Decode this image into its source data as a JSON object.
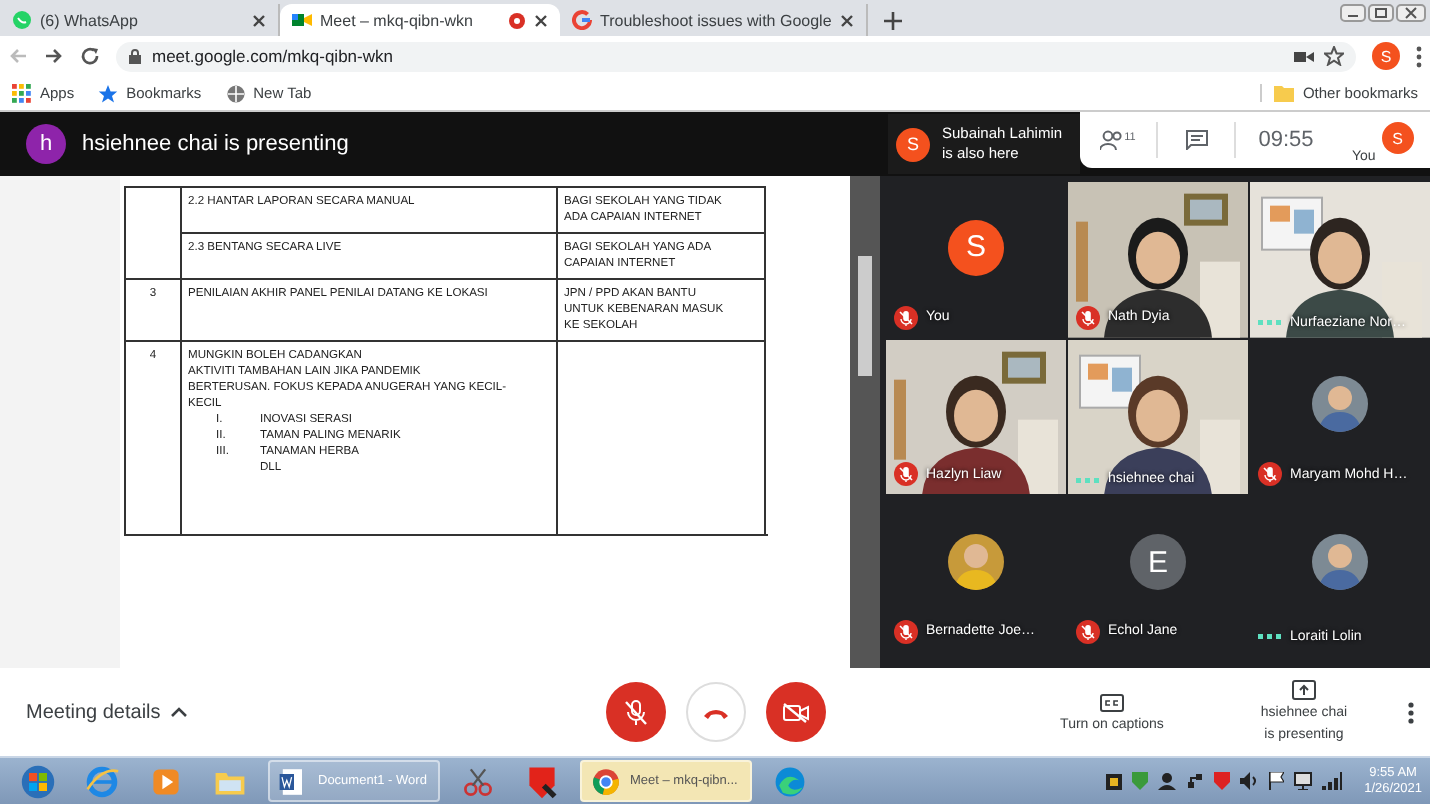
{
  "browser": {
    "tabs": [
      {
        "title": "(6) WhatsApp",
        "kind": "whatsapp",
        "selected": false,
        "capturing": false
      },
      {
        "title": "Meet – mkq-qibn-wkn",
        "kind": "meet",
        "selected": true,
        "capturing": true
      },
      {
        "title": "Troubleshoot issues with Google",
        "kind": "google",
        "selected": false,
        "capturing": false
      }
    ],
    "address": "meet.google.com/mkq-qibn-wkn",
    "profile": "S",
    "bookmarks": [
      {
        "label": "Apps",
        "kind": "apps"
      },
      {
        "label": "Bookmarks",
        "kind": "star"
      },
      {
        "label": "New Tab",
        "kind": "globe"
      }
    ],
    "other_bookmarks": "Other bookmarks"
  },
  "meet": {
    "presenter_initial": "h",
    "presenting_text": "hsiehnee chai is presenting",
    "notice": {
      "initial": "S",
      "lines": [
        "Subainah Lahimin",
        "is also here"
      ]
    },
    "people_count": "11",
    "time": "09:55",
    "self": {
      "label": "You",
      "initial": "S"
    },
    "document": {
      "rows": [
        {
          "number": "",
          "content": [
            {
              "kind": "line",
              "text": "2.2 HANTAR LAPORAN SECARA MANUAL"
            }
          ],
          "note": [
            "BAGI SEKOLAH YANG TIDAK",
            "ADA CAPAIAN INTERNET"
          ]
        },
        {
          "number": "",
          "content": [
            {
              "kind": "line",
              "text": "2.3 BENTANG SECARA LIVE"
            }
          ],
          "note": [
            "BAGI SEKOLAH YANG ADA",
            "CAPAIAN INTERNET"
          ]
        },
        {
          "number": "3",
          "content": [
            {
              "kind": "line",
              "text": "PENILAIAN AKHIR PANEL PENILAI  DATANG KE LOKASI"
            }
          ],
          "note": [
            "JPN / PPD AKAN BANTU",
            "UNTUK KEBENARAN MASUK",
            "KE SEKOLAH"
          ]
        },
        {
          "number": "4",
          "content": [
            {
              "kind": "line",
              "text": "MUNGKIN BOLEH CADANGKAN"
            },
            {
              "kind": "line",
              "text": "AKTIVITI  TAMBAHAN LAIN JIKA PANDEMIK"
            },
            {
              "kind": "line",
              "text": "BERTERUSAN. FOKUS KEPADA ANUGERAH YANG KECIL-"
            },
            {
              "kind": "line",
              "text": "KECIL"
            },
            {
              "kind": "item",
              "marker": "I.",
              "text": "INOVASI SERASI"
            },
            {
              "kind": "item",
              "marker": "II.",
              "text": "TAMAN PALING MENARIK"
            },
            {
              "kind": "item",
              "marker": "III.",
              "text": "TANAMAN HERBA"
            },
            {
              "kind": "indent",
              "text": "DLL"
            }
          ],
          "note": []
        }
      ]
    },
    "participants": [
      {
        "name": "You",
        "kind": "avatar",
        "initial": "S",
        "color": "#f4511e",
        "muted": true
      },
      {
        "name": "Nath Dyia",
        "kind": "video",
        "muted": true
      },
      {
        "name": "Nurfaeziane Nor…",
        "kind": "video",
        "muted": false
      },
      {
        "name": "Hazlyn Liaw",
        "kind": "video",
        "muted": true
      },
      {
        "name": "hsiehnee chai",
        "kind": "video",
        "muted": false
      },
      {
        "name": "Maryam Mohd H…",
        "muted": true
      },
      {
        "name": "Bernadette Joe…",
        "muted": true
      },
      {
        "name": "Echol Jane",
        "kind": "avatar",
        "initial": "E",
        "color": "#5f6368",
        "muted": true
      },
      {
        "name": "Loraiti Lolin",
        "muted": false
      }
    ],
    "controls": {
      "meeting_details": "Meeting details",
      "mic_on": false,
      "camera_on": false,
      "captions": "Turn on captions",
      "presenting": [
        "hsiehnee chai",
        "is presenting"
      ]
    }
  },
  "taskbar": {
    "items": [
      {
        "kind": "start",
        "selected": false
      },
      {
        "kind": "ie",
        "selected": false
      },
      {
        "kind": "media",
        "selected": false
      },
      {
        "kind": "explorer",
        "selected": false
      },
      {
        "kind": "word",
        "label": "Document1 - Word",
        "selected": false
      },
      {
        "kind": "snip",
        "selected": false
      },
      {
        "kind": "kaspersky",
        "selected": false
      },
      {
        "kind": "chrome",
        "label": "Meet – mkq-qibn...",
        "selected": true
      },
      {
        "kind": "edge",
        "selected": false
      }
    ],
    "clock": {
      "time": "9:55 AM",
      "date": "1/26/2021"
    }
  }
}
